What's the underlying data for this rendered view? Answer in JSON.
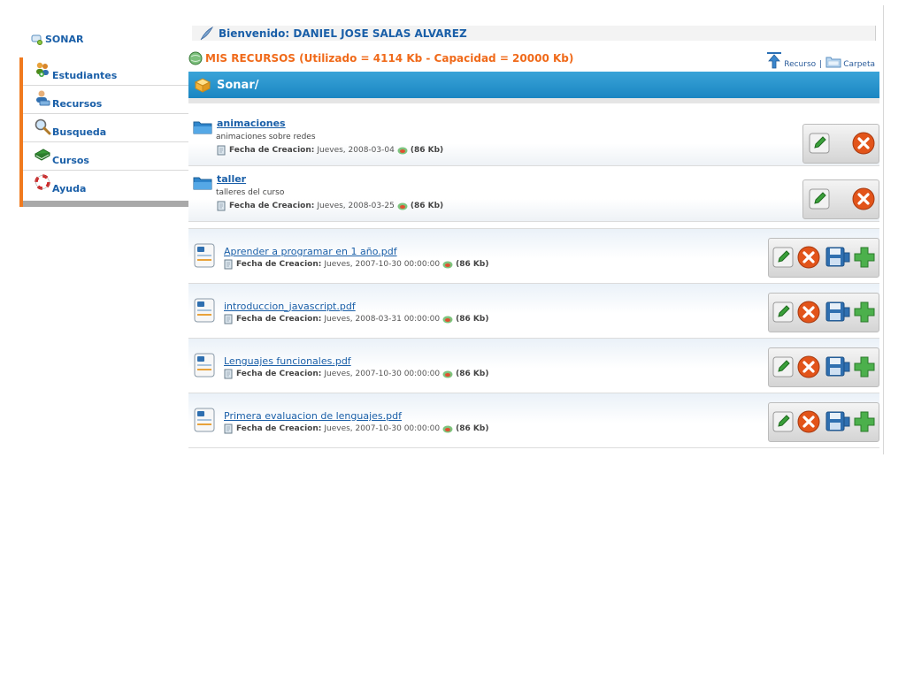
{
  "brand": {
    "label": "SONAR"
  },
  "sidebar": {
    "items": [
      {
        "label": "Estudiantes",
        "icon": "students-icon"
      },
      {
        "label": "Recursos",
        "icon": "resources-icon"
      },
      {
        "label": "Busqueda",
        "icon": "search-icon"
      },
      {
        "label": "Cursos",
        "icon": "book-icon"
      },
      {
        "label": "Ayuda",
        "icon": "lifebuoy-icon"
      }
    ]
  },
  "header": {
    "welcome": "Bienvenido: DANIEL JOSE SALAS ALVAREZ",
    "resources": "MIS RECURSOS (Utilizado = 4114 Kb - Capacidad = 20000 Kb)",
    "actions": {
      "recurso": "Recurso",
      "separator": "|",
      "carpeta": "Carpeta"
    }
  },
  "folderbar": {
    "title": "Sonar/"
  },
  "labels": {
    "fecha_de_creacion": "Fecha de Creacion:"
  },
  "folders": [
    {
      "name": "animaciones",
      "description": "animaciones sobre redes",
      "date": "Jueves, 2008-03-04",
      "size": "(86 Kb)"
    },
    {
      "name": "taller",
      "description": "talleres del curso",
      "date": "Jueves, 2008-03-25",
      "size": "(86 Kb)"
    }
  ],
  "files": [
    {
      "name": "Aprender a programar en 1 año.pdf",
      "date": "Jueves, 2007-10-30 00:00:00",
      "size": "(86 Kb)"
    },
    {
      "name": "introduccion_javascript.pdf",
      "date": "Jueves, 2008-03-31 00:00:00",
      "size": "(86 Kb)"
    },
    {
      "name": "Lenguajes funcionales.pdf",
      "date": "Jueves, 2007-10-30 00:00:00",
      "size": "(86 Kb)"
    },
    {
      "name": "Primera evaluacion de lenguajes.pdf",
      "date": "Jueves, 2007-10-30 00:00:00",
      "size": "(86 Kb)"
    }
  ],
  "colors": {
    "accent_orange": "#f06a1a",
    "link_blue": "#1a5fa8",
    "bar_blue": "#1a86c2"
  }
}
